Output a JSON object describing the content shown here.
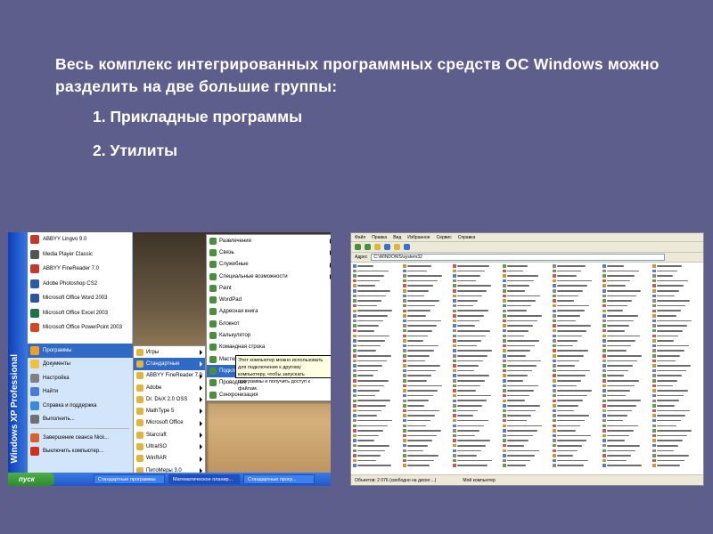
{
  "slide": {
    "paragraph": "Весь комплекс интегрированных программных средств ОС Windows можно разделить на две большие группы:",
    "item1": "1. Прикладные программы",
    "item2": "2. Утилиты"
  },
  "left_screenshot": {
    "xp_band": "Windows XP Professional",
    "start_menu_pinned": [
      {
        "label": "ABBYY Lingvo 9.0",
        "color": "#c0392b"
      },
      {
        "label": "Media Player Classic",
        "color": "#555555"
      },
      {
        "label": "ABBYY FineReader 7.0",
        "color": "#c0392b"
      },
      {
        "label": "Adobe Photoshop CS2",
        "color": "#2c5aa0"
      },
      {
        "label": "Microsoft Office Word 2003",
        "color": "#2b579a"
      },
      {
        "label": "Microsoft Office Excel 2003",
        "color": "#217346"
      },
      {
        "label": "Microsoft Office PowerPoint 2003",
        "color": "#d24726"
      }
    ],
    "start_menu_right": [
      {
        "label": "Программы",
        "highlight": true
      },
      {
        "label": "Документы"
      },
      {
        "label": "Настройка"
      },
      {
        "label": "Найти"
      },
      {
        "label": "Справка и поддержка"
      },
      {
        "label": "Выполнить..."
      },
      {
        "label": "Завершение сеанса Nick..."
      },
      {
        "label": "Выключить компьютер..."
      }
    ],
    "programs_menu": [
      {
        "label": "Игры",
        "arrow": true
      },
      {
        "label": "Стандартные",
        "arrow": true,
        "highlight": true
      },
      {
        "label": "ABBYY FineReader 7.0",
        "arrow": true
      },
      {
        "label": "Adobe",
        "arrow": true
      },
      {
        "label": "Dr. DivX 2.0 OSS",
        "arrow": true
      },
      {
        "label": "MathType 5",
        "arrow": true
      },
      {
        "label": "Microsoft Office",
        "arrow": true
      },
      {
        "label": "Starcraft",
        "arrow": true
      },
      {
        "label": "UltraISO",
        "arrow": true
      },
      {
        "label": "WinRAR",
        "arrow": true
      },
      {
        "label": "ПитоМеры 3.0",
        "arrow": true
      },
      {
        "label": "Игры Alawar.ru",
        "arrow": true
      },
      {
        "label": "LizardTech",
        "arrow": true
      }
    ],
    "accessories_menu": [
      {
        "label": "Развлечения",
        "arrow": true
      },
      {
        "label": "Связь",
        "arrow": true
      },
      {
        "label": "Служебные",
        "arrow": true
      },
      {
        "label": "Специальные возможности",
        "arrow": true
      },
      {
        "label": "Paint"
      },
      {
        "label": "WordPad"
      },
      {
        "label": "Адресная книга"
      },
      {
        "label": "Блокнот"
      },
      {
        "label": "Калькулятор"
      },
      {
        "label": "Командная строка"
      },
      {
        "label": "Мастер совместимости программ"
      },
      {
        "label": "Подключение к удаленному рабочему столу",
        "highlight": true
      },
      {
        "label": "Проводник"
      },
      {
        "label": "Синхронизация"
      }
    ],
    "tooltip": "Этот компьютер можно использовать для подключения к другому компьютеру, чтобы запускать программы и получить доступ к файлам.",
    "taskbar": {
      "start": "пуск",
      "tasks": [
        "Стандартные программы",
        "Математическое планир...",
        "Стандартные прогр..."
      ]
    }
  },
  "right_screenshot": {
    "menubar": [
      "Файл",
      "Правка",
      "Вид",
      "Избранное",
      "Сервис",
      "Справка"
    ],
    "address_label": "Адрес",
    "address_value": "C:\\WINDOWS\\system32",
    "status": [
      "Объектов: 2 076 (свободно на диске:...)",
      "Мой компьютер"
    ]
  }
}
